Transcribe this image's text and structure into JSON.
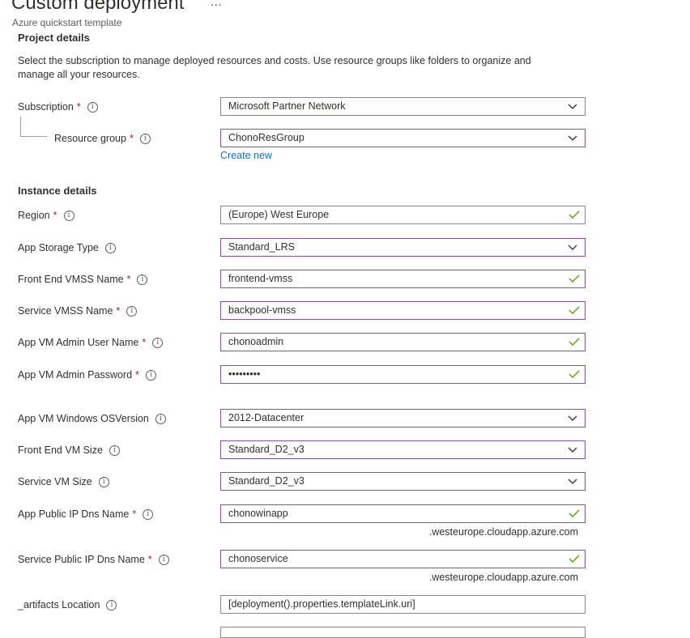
{
  "header": {
    "title": "Custom deployment",
    "subtitle": "Azure quickstart template",
    "more_label": "..."
  },
  "project": {
    "heading": "Project details",
    "description": "Select the subscription to manage deployed resources and costs. Use resource groups like folders to organize and manage all your resources."
  },
  "fields": {
    "subscription": {
      "label": "Subscription",
      "value": "Microsoft Partner Network"
    },
    "resource_group": {
      "label": "Resource group",
      "value": "ChonoResGroup",
      "create_new": "Create new"
    },
    "region": {
      "label": "Region",
      "value": "(Europe) West Europe"
    },
    "app_storage_type": {
      "label": "App Storage Type",
      "value": "Standard_LRS"
    },
    "front_end_vmss_name": {
      "label": "Front End VMSS Name",
      "value": "frontend-vmss"
    },
    "service_vmss_name": {
      "label": "Service VMSS Name",
      "value": "backpool-vmss"
    },
    "admin_user": {
      "label": "App VM Admin User Name",
      "value": "chonoadmin"
    },
    "admin_password": {
      "label": "App VM Admin Password",
      "value": "•••••••••"
    },
    "os_version": {
      "label": "App VM Windows OSVersion",
      "value": "2012-Datacenter"
    },
    "front_end_vm_size": {
      "label": "Front End VM Size",
      "value": "Standard_D2_v3"
    },
    "service_vm_size": {
      "label": "Service VM Size",
      "value": "Standard_D2_v3"
    },
    "app_public_dns": {
      "label": "App Public IP Dns Name",
      "value": "chonowinapp",
      "suffix": ".westeurope.cloudapp.azure.com"
    },
    "service_public_dns": {
      "label": "Service Public IP Dns Name",
      "value": "chonoservice",
      "suffix": ".westeurope.cloudapp.azure.com"
    },
    "artifacts_location": {
      "label": "_artifacts Location",
      "value": "[deployment().properties.templateLink.uri]"
    }
  },
  "instance": {
    "heading": "Instance details"
  },
  "required_marker": "*",
  "info_glyph": "i",
  "colors": {
    "accent_border": "#7d55a8",
    "valid_check": "#57a300",
    "link": "#0078d4",
    "required": "#a4262c"
  }
}
